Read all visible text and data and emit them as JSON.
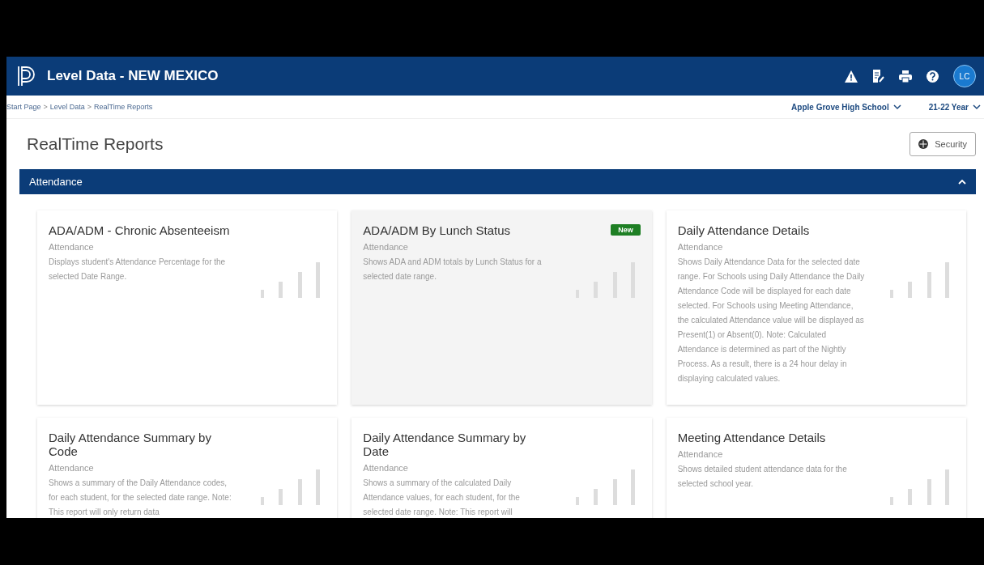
{
  "header": {
    "title": "Level Data - NEW MEXICO",
    "avatar": "LC"
  },
  "breadcrumb": {
    "items": [
      "Start Page",
      "Level Data",
      "RealTime Reports"
    ],
    "separator": ">"
  },
  "selectors": [
    {
      "label": "Apple Grove High School"
    },
    {
      "label": "21-22 Year"
    }
  ],
  "page": {
    "title": "RealTime Reports",
    "security_button": "Security"
  },
  "section": {
    "title": "Attendance",
    "expanded": true
  },
  "reports": [
    {
      "title": "ADA/ADM - Chronic Absenteeism",
      "category": "Attendance",
      "description": "Displays student's Attendance Percentage for the selected Date Range.",
      "hovered": false
    },
    {
      "title": "ADA/ADM By Lunch Status",
      "category": "Attendance",
      "description": "Shows ADA and ADM totals by Lunch Status for a selected date range.",
      "badge": "New",
      "hovered": true
    },
    {
      "title": "Daily Attendance Details",
      "category": "Attendance",
      "description": "Shows Daily Attendance Data for the selected date range. For Schools using Daily Attendance the Daily Attendance Code will be displayed for each date selected. For Schools using Meeting Attendance, the calculated Attendance value will be displayed as Present(1) or Absent(0). Note: Calculated Attendance is determined as part of the Nightly Process. As a result, there is a 24 hour delay in displaying calculated values.",
      "hovered": false
    },
    {
      "title": "Daily Attendance Summary by Code",
      "category": "Attendance",
      "description": "Shows a summary of the Daily Attendance codes, for each student, for the selected date range. Note: This report will only return data",
      "hovered": false
    },
    {
      "title": "Daily Attendance Summary by Date",
      "category": "Attendance",
      "description": "Shows a summary of the calculated Daily Attendance values, for each student, for the selected date range. Note: This report will",
      "hovered": false
    },
    {
      "title": "Meeting Attendance Details",
      "category": "Attendance",
      "description": "Shows detailed student attendance data for the selected school year.",
      "hovered": false
    }
  ]
}
